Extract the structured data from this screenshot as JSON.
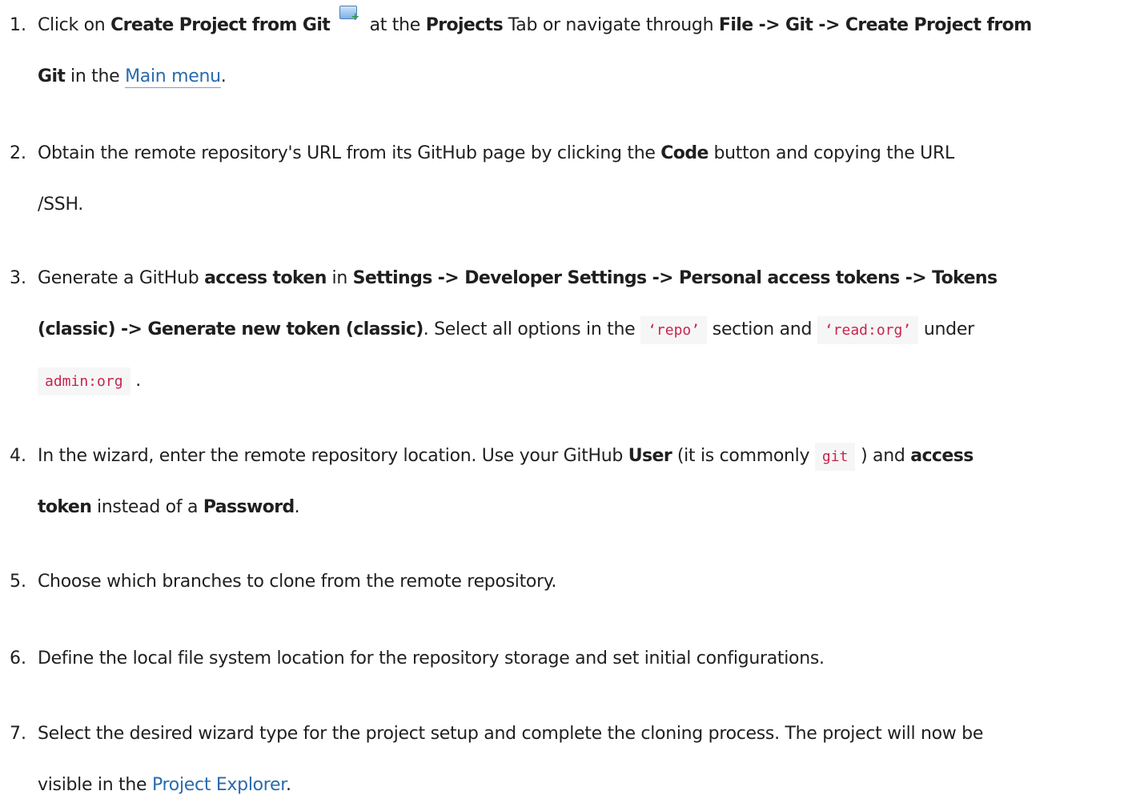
{
  "steps": [
    {
      "number": "1.",
      "parts": {
        "a": "Click on ",
        "b": "Create Project from Git",
        "icon_label": "GIT",
        "c": " at the ",
        "d": "Projects",
        "e": " Tab or navigate through ",
        "f": "File -> Git -> Create Project from",
        "g": "Git",
        "h": " in the ",
        "link": "Main menu",
        "i": "."
      }
    },
    {
      "number": "2.",
      "parts": {
        "a": "Obtain the remote repository's URL from its GitHub page by clicking the ",
        "b": "Code",
        "c": " button and copying the URL",
        "d": "/SSH."
      }
    },
    {
      "number": "3.",
      "parts": {
        "a": "Generate a GitHub ",
        "b": "access token",
        "c": " in ",
        "d": "Settings -> Developer Settings -> Personal access tokens -> Tokens",
        "e": "(classic) -> Generate new token (classic)",
        "f": ". Select all options in the ",
        "code1": "‘repo’",
        "g": " section and ",
        "code2": "‘read:org’",
        "h": " under",
        "code3": "admin:org",
        "i": " ."
      }
    },
    {
      "number": "4.",
      "parts": {
        "a": "In the wizard, enter the remote repository location. Use your GitHub ",
        "b": "User",
        "c": " (it is commonly ",
        "code1": "git",
        "d": " ) and ",
        "e": "access",
        "f": "token",
        "g": " instead of a ",
        "h": "Password",
        "i": "."
      }
    },
    {
      "number": "5.",
      "parts": {
        "a": "Choose which branches to clone from the remote repository."
      }
    },
    {
      "number": "6.",
      "parts": {
        "a": "Define the local file system location for the repository storage and set initial configurations."
      }
    },
    {
      "number": "7.",
      "parts": {
        "a": "Select the desired wizard type for the project setup and complete the cloning process. The project will now be",
        "b": "visible in the ",
        "link": "Project Explorer",
        "c": "."
      }
    }
  ],
  "colors": {
    "text": "#1f1f1f",
    "link": "#2a6aad",
    "code_text": "#c7254e",
    "code_background": "#f6f6f6"
  },
  "icons": {
    "git_create_project": "git-create-project-icon"
  }
}
